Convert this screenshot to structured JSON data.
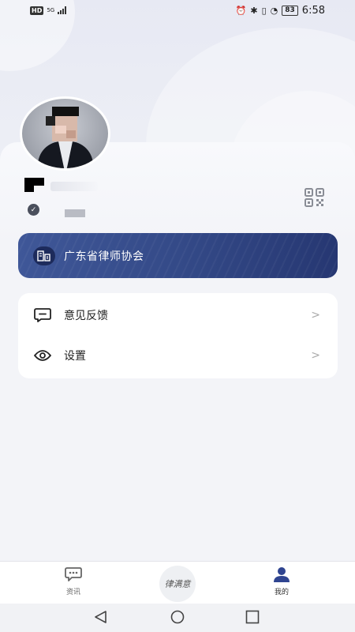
{
  "status_bar": {
    "network_badge": "HD",
    "network_type": "5G",
    "battery": "83",
    "time": "6:58"
  },
  "profile": {
    "avatar_label": "avatar"
  },
  "association": {
    "label": "广东省律师协会"
  },
  "menu": {
    "items": [
      {
        "label": "意见反馈",
        "icon": "feedback-icon"
      },
      {
        "label": "设置",
        "icon": "eye-settings-icon"
      }
    ],
    "arrow": ">"
  },
  "bottom_nav": {
    "items": [
      {
        "label": "资讯",
        "icon": "chat-bubble-icon",
        "active": false
      },
      {
        "label": "律满意",
        "icon": "app-logo",
        "active": false
      },
      {
        "label": "我的",
        "icon": "person-icon",
        "active": true
      }
    ]
  },
  "colors": {
    "accent": "#2f4490",
    "banner_start": "#3f5798",
    "banner_end": "#263772",
    "background": "#f3f4f8"
  }
}
